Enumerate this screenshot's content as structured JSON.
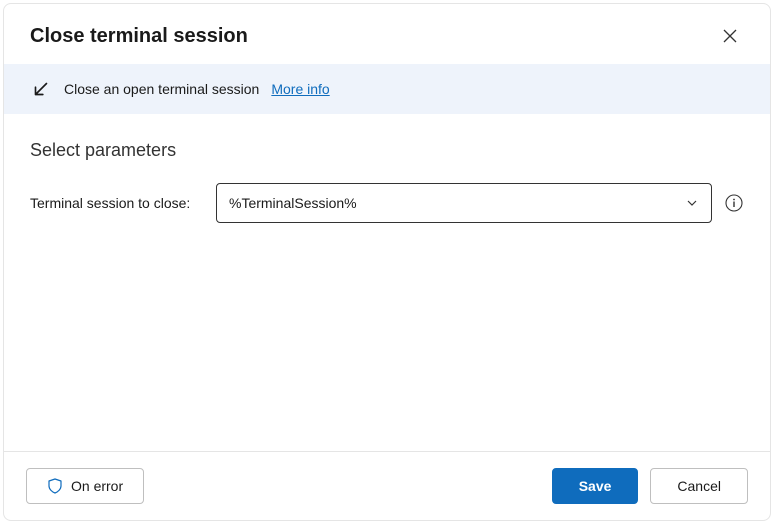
{
  "header": {
    "title": "Close terminal session"
  },
  "info": {
    "description": "Close an open terminal session",
    "link_text": "More info"
  },
  "content": {
    "section_title": "Select parameters",
    "param_label": "Terminal session to close:",
    "dropdown_value": "%TerminalSession%"
  },
  "footer": {
    "on_error_label": "On error",
    "save_label": "Save",
    "cancel_label": "Cancel"
  }
}
